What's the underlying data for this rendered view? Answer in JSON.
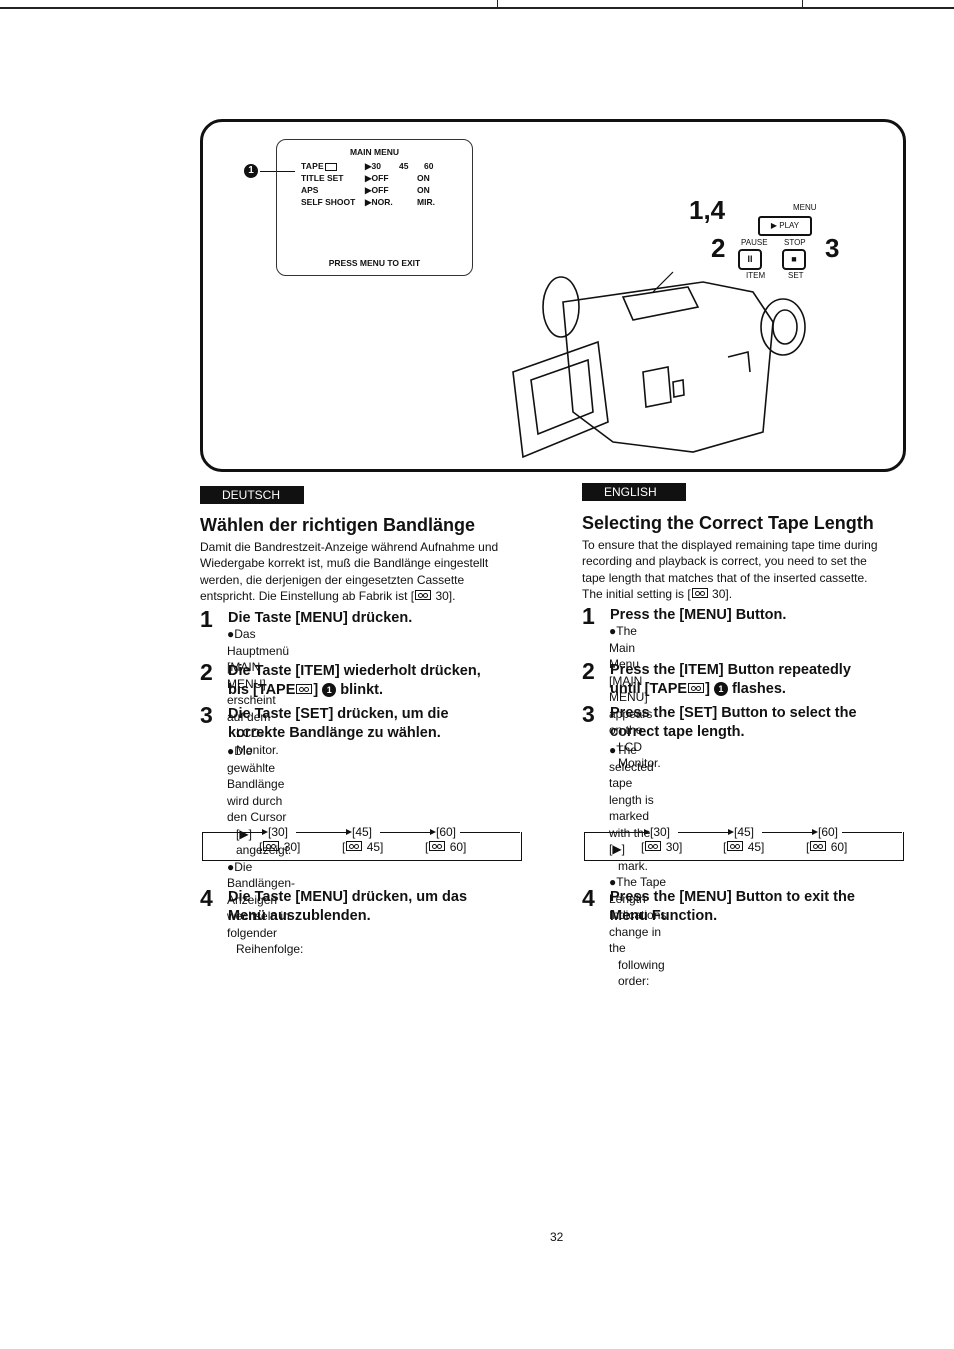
{
  "page_number": "32",
  "figure": {
    "callout_marker": "1",
    "osd": {
      "title": "MAIN MENU",
      "rows": [
        {
          "label": "TAPE",
          "values": [
            "▶30",
            "45",
            "60"
          ]
        },
        {
          "label": "TITLE SET",
          "values": [
            "▶OFF",
            "ON"
          ]
        },
        {
          "label": "APS",
          "values": [
            "▶OFF",
            "ON"
          ]
        },
        {
          "label": "SELF SHOOT",
          "values": [
            "▶NOR.",
            "MIR."
          ]
        }
      ],
      "footer": "PRESS MENU TO EXIT"
    },
    "controls": {
      "step_menu": "1,4",
      "menu_label": "MENU",
      "play_label": "▶ PLAY",
      "step_item": "2",
      "pause_label": "PAUSE",
      "pause_glyph": "II",
      "item_label": "ITEM",
      "step_set": "3",
      "stop_label": "STOP",
      "stop_glyph": "■",
      "set_label": "SET"
    }
  },
  "deutsch": {
    "lang_tag": "DEUTSCH",
    "title": "Wählen der richtigen Bandlänge",
    "intro_lines": [
      "Damit die Bandrestzeit-Anzeige während Aufnahme und",
      "Wiedergabe korrekt ist, muß die Bandlänge eingestellt",
      "werden, die derjenigen der eingesetzten Cassette",
      "entspricht. Die Einstellung ab Fabrik ist [",
      " 30]."
    ],
    "steps": [
      {
        "num": "1",
        "lines": [
          "Die Taste [MENU] drücken."
        ],
        "bullets": [
          [
            "●Das Hauptmenü [MAIN MENU] erscheint auf dem",
            "LCD-Monitor."
          ]
        ]
      },
      {
        "num": "2",
        "lines": [
          "Die Taste [ITEM] wiederholt drücken,",
          "bis [TAPE",
          "] ",
          " blinkt."
        ]
      },
      {
        "num": "3",
        "lines": [
          "Die Taste [SET] drücken, um die",
          "korrekte Bandlänge zu wählen."
        ],
        "bullets": [
          [
            "●Die gewählte Bandlänge wird durch den Cursor",
            "[▶] angezeigt."
          ],
          [
            "●Die Bandlängen-Anzeigen wechseln in folgender",
            "Reihenfolge:"
          ]
        ]
      },
      {
        "num": "4",
        "lines": [
          "Die Taste [MENU] drücken, um das",
          "Menü auszublenden."
        ]
      }
    ],
    "sequence": [
      {
        "bracket": "[30]",
        "cassette": "30"
      },
      {
        "bracket": "[45]",
        "cassette": "45"
      },
      {
        "bracket": "[60]",
        "cassette": "60"
      }
    ]
  },
  "english": {
    "lang_tag": "ENGLISH",
    "title": "Selecting the Correct Tape Length",
    "intro_lines": [
      "To ensure that the displayed remaining tape time during",
      "recording and playback is correct, you need to set the",
      "tape length that matches that of the inserted cassette.",
      "The initial setting is [",
      " 30]."
    ],
    "steps": [
      {
        "num": "1",
        "lines": [
          "Press the [MENU] Button."
        ],
        "bullets": [
          [
            "●The Main Menu [MAIN MENU] appears on the",
            "LCD Monitor."
          ]
        ]
      },
      {
        "num": "2",
        "lines": [
          "Press the [ITEM] Button repeatedly",
          "until [TAPE",
          "] ",
          " flashes."
        ]
      },
      {
        "num": "3",
        "lines": [
          "Press the [SET] Button to select the",
          "correct tape length."
        ],
        "bullets": [
          [
            "●The selected tape length is marked with the [▶]",
            "mark."
          ],
          [
            "●The Tape Length Indications change in the",
            "following order:"
          ]
        ]
      },
      {
        "num": "4",
        "lines": [
          "Press the [MENU] Button to exit the",
          "Menu Function."
        ]
      }
    ],
    "sequence": [
      {
        "bracket": "[30]",
        "cassette": "30"
      },
      {
        "bracket": "[45]",
        "cassette": "45"
      },
      {
        "bracket": "[60]",
        "cassette": "60"
      }
    ]
  }
}
